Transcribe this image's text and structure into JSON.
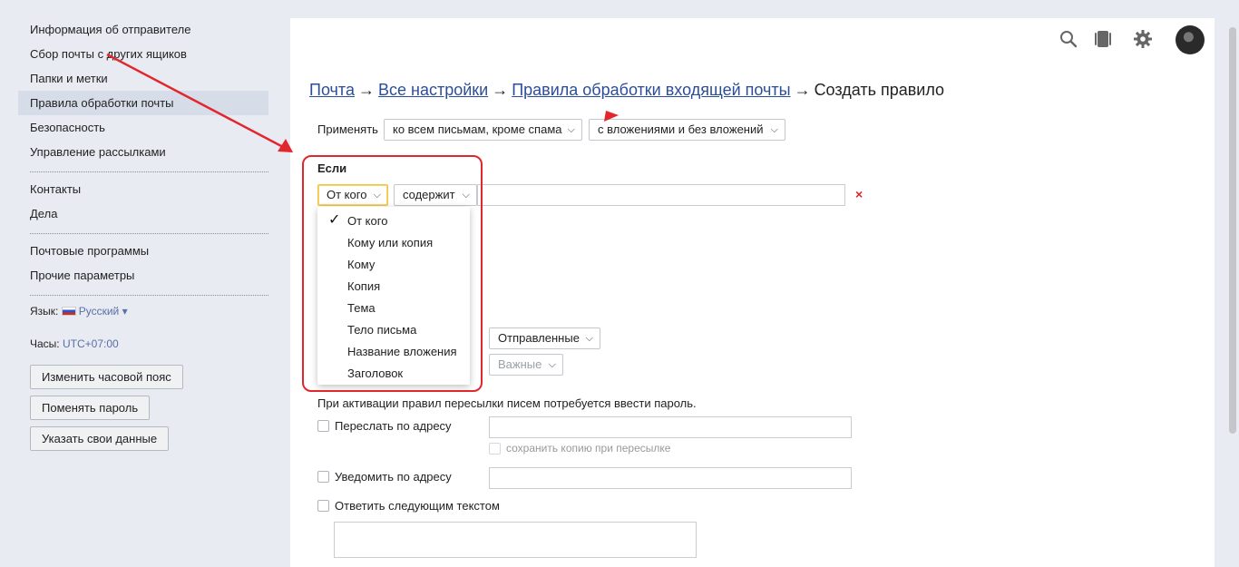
{
  "sidebar": {
    "items": [
      {
        "label": "Информация об отправителе"
      },
      {
        "label": "Сбор почты с других ящиков"
      },
      {
        "label": "Папки и метки"
      },
      {
        "label": "Правила обработки почты"
      },
      {
        "label": "Безопасность"
      },
      {
        "label": "Управление рассылками"
      }
    ],
    "items2": [
      {
        "label": "Контакты"
      },
      {
        "label": "Дела"
      }
    ],
    "items3": [
      {
        "label": "Почтовые программы"
      },
      {
        "label": "Прочие параметры"
      }
    ],
    "language_label": "Язык:",
    "language_value": "Русский",
    "language_caret": "▾",
    "clock_label": "Часы:",
    "clock_value": "UTC+07:00",
    "buttons": {
      "timezone": "Изменить часовой пояс",
      "password": "Поменять пароль",
      "personal": "Указать свои данные"
    }
  },
  "breadcrumb": {
    "mail": "Почта",
    "all_settings": "Все настройки",
    "rules": "Правила обработки входящей почты",
    "current": "Создать правило",
    "arrow": "→"
  },
  "rule": {
    "apply_label": "Применять",
    "apply_scope": "ко всем письмам, кроме спама",
    "apply_attachments": "с вложениями и без вложений",
    "if_label": "Если",
    "field_select": "От кого",
    "condition_select": "содержит",
    "condition_value": "",
    "folder_select": "Отправленные",
    "label_select": "Важные",
    "password_note": "При активации правил пересылки писем потребуется ввести пароль.",
    "forward_label": "Переслать по адресу",
    "keep_copy_label": "сохранить копию при пересылке",
    "notify_label": "Уведомить по адресу",
    "reply_label": "Ответить следующим текстом",
    "delete_mark": "×"
  },
  "dropdown": {
    "selected": "От кого",
    "check_mark": "✓",
    "options": [
      "От кого",
      "Кому или копия",
      "Кому",
      "Копия",
      "Тема",
      "Тело письма",
      "Название вложения",
      "Заголовок"
    ]
  },
  "header_icons": [
    "search-icon",
    "mobile-icon",
    "gear-icon",
    "avatar"
  ],
  "colors": {
    "accent_link": "#2b4e9c",
    "annotation": "#e2262d",
    "active_item": "#d6dce8"
  }
}
